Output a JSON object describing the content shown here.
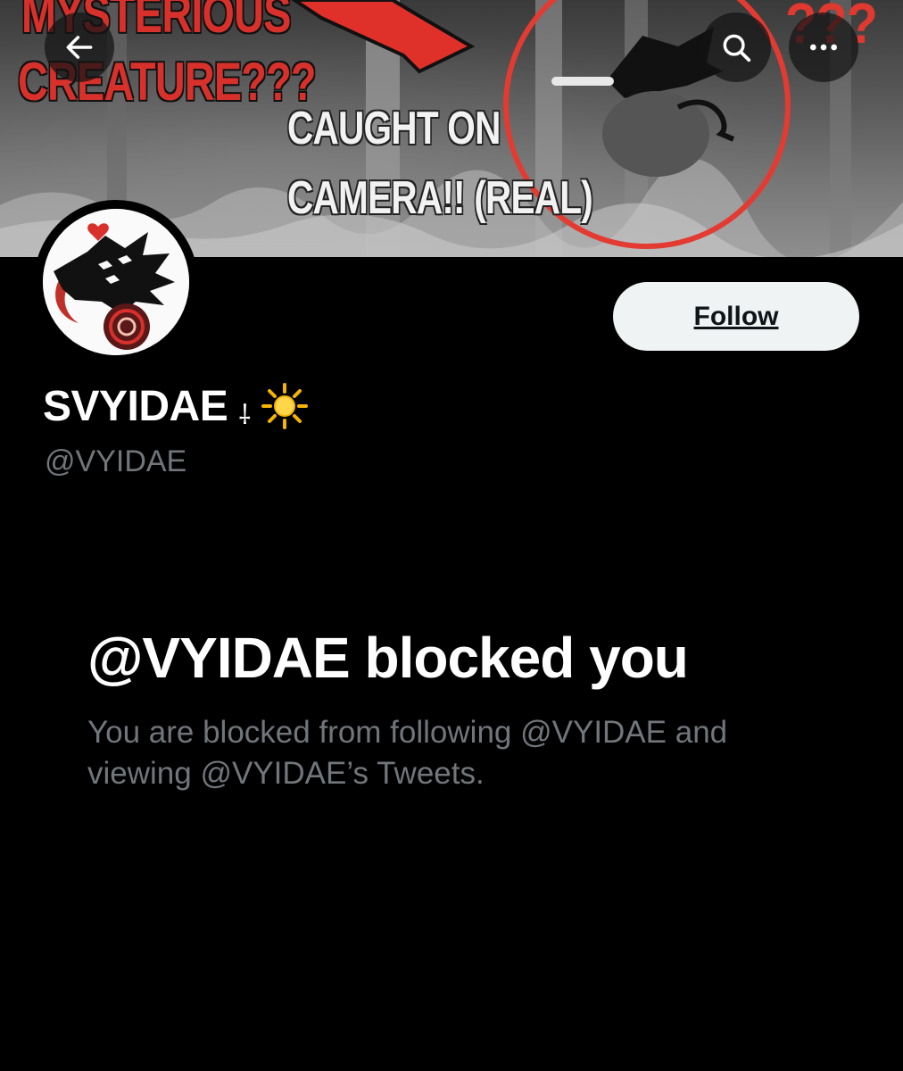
{
  "banner": {
    "line1": "MYSTERIOUS",
    "line2": "CREATURE???",
    "line3": "CAUGHT ON",
    "line4": "CAMERA!! (REAL)",
    "question_marks": "???"
  },
  "nav": {
    "back_icon": "arrow-left-icon",
    "search_icon": "search-icon",
    "more_icon": "more-horizontal-icon"
  },
  "profile": {
    "display_name": "SVYIDAE",
    "name_glyph": "⸸",
    "name_emoji": "sun-emoji",
    "handle": "@VYIDAE",
    "follow_label": "Follow"
  },
  "blocked": {
    "title": "@VYIDAE blocked you",
    "body_line1": "You are blocked from following @VYIDAE and",
    "body_line2": "viewing @VYIDAE’s Tweets."
  },
  "colors": {
    "background": "#000000",
    "secondary_text": "#71767b",
    "follow_bg": "#eff3f4",
    "accent_red": "#d8312b"
  }
}
